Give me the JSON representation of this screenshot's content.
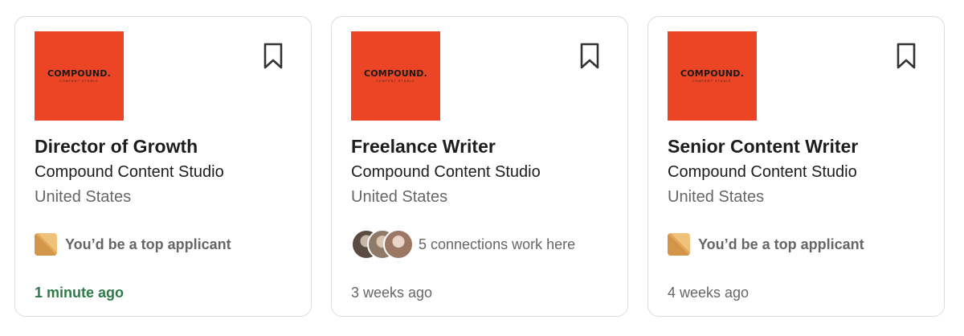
{
  "jobs": [
    {
      "logo": {
        "word": "COMPOUND.",
        "sub": "CONTENT STUDIO",
        "bg": "#eb4525"
      },
      "title": "Director of Growth",
      "company": "Compound Content Studio",
      "location": "United States",
      "insight": {
        "icon": "top-applicant-badge-icon",
        "text": "You’d be a top applicant"
      },
      "posted": "1 minute ago",
      "posted_color": "#2f7a49"
    },
    {
      "logo": {
        "word": "COMPOUND.",
        "sub": "CONTENT STUDIO",
        "bg": "#eb4525"
      },
      "title": "Freelance Writer",
      "company": "Compound Content Studio",
      "location": "United States",
      "insight": {
        "icon": "connections-avatars",
        "text": "5 connections work here"
      },
      "posted": "3 weeks ago",
      "posted_color": "#666666"
    },
    {
      "logo": {
        "word": "COMPOUND.",
        "sub": "CONTENT STUDIO",
        "bg": "#eb4525"
      },
      "title": "Senior Content Writer",
      "company": "Compound Content Studio",
      "location": "United States",
      "insight": {
        "icon": "top-applicant-badge-icon",
        "text": "You’d be a top applicant"
      },
      "posted": "4 weeks ago",
      "posted_color": "#666666"
    }
  ],
  "icons": {
    "save": "bookmark-icon"
  },
  "colors": {
    "brand_logo": "#eb4525",
    "recent_post": "#2f7a49",
    "muted_text": "#666666",
    "badge": "#e2a95a"
  }
}
